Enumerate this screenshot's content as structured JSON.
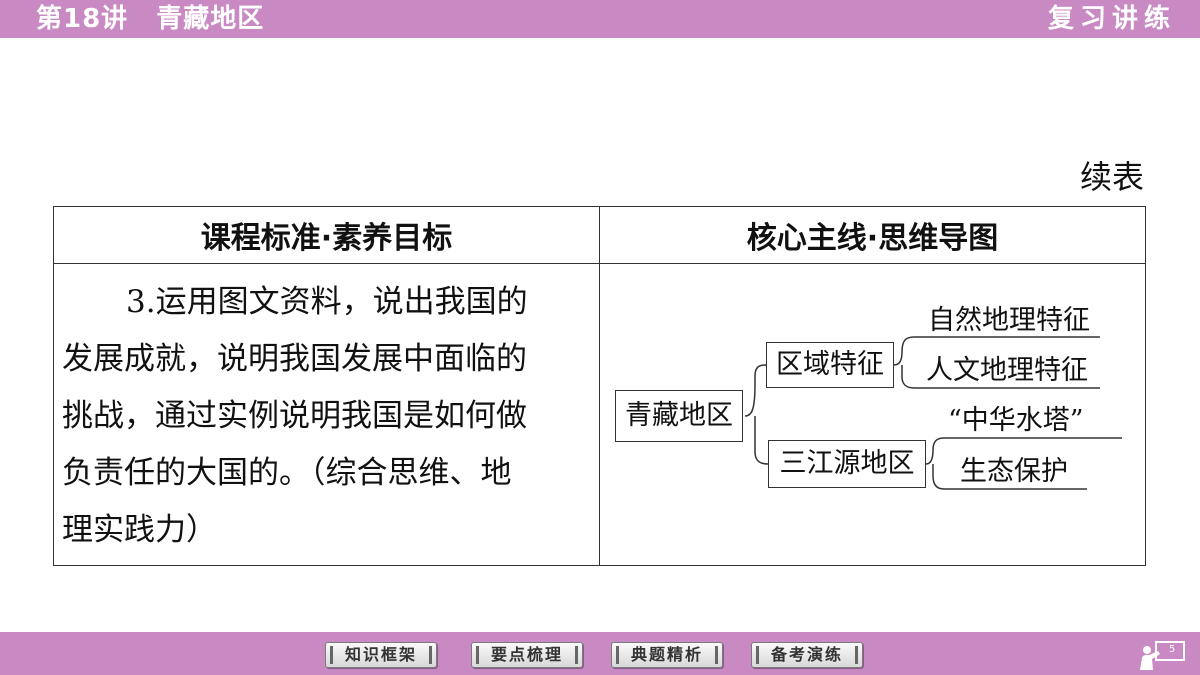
{
  "header": {
    "lesson_number": "第18讲",
    "lesson_title": "青藏地区",
    "series_title": "复习讲练"
  },
  "continued_label": "续表",
  "table": {
    "col1_header": "课程标准·素养目标",
    "col2_header": "核心主线·思维导图",
    "standard_lines": [
      "3.运用图文资料，说出我国的",
      "发展成就，说明我国发展中面临的",
      "挑战，通过实例说明我国是如何做",
      "负责任的大国的。（综合思维、地",
      "理实践力）"
    ]
  },
  "mindmap": {
    "root": "青藏地区",
    "branch1": "区域特征",
    "branch1_leaves": [
      "自然地理特征",
      "人文地理特征"
    ],
    "branch2": "三江源地区",
    "branch2_leaves": [
      "“中华水塔”",
      "生态保护"
    ]
  },
  "nav": {
    "buttons": [
      "知识框架",
      "要点梳理",
      "典题精析",
      "备考演练"
    ],
    "page_number": "5"
  },
  "colors": {
    "bar": "#c98ac3",
    "line": "#333333"
  }
}
